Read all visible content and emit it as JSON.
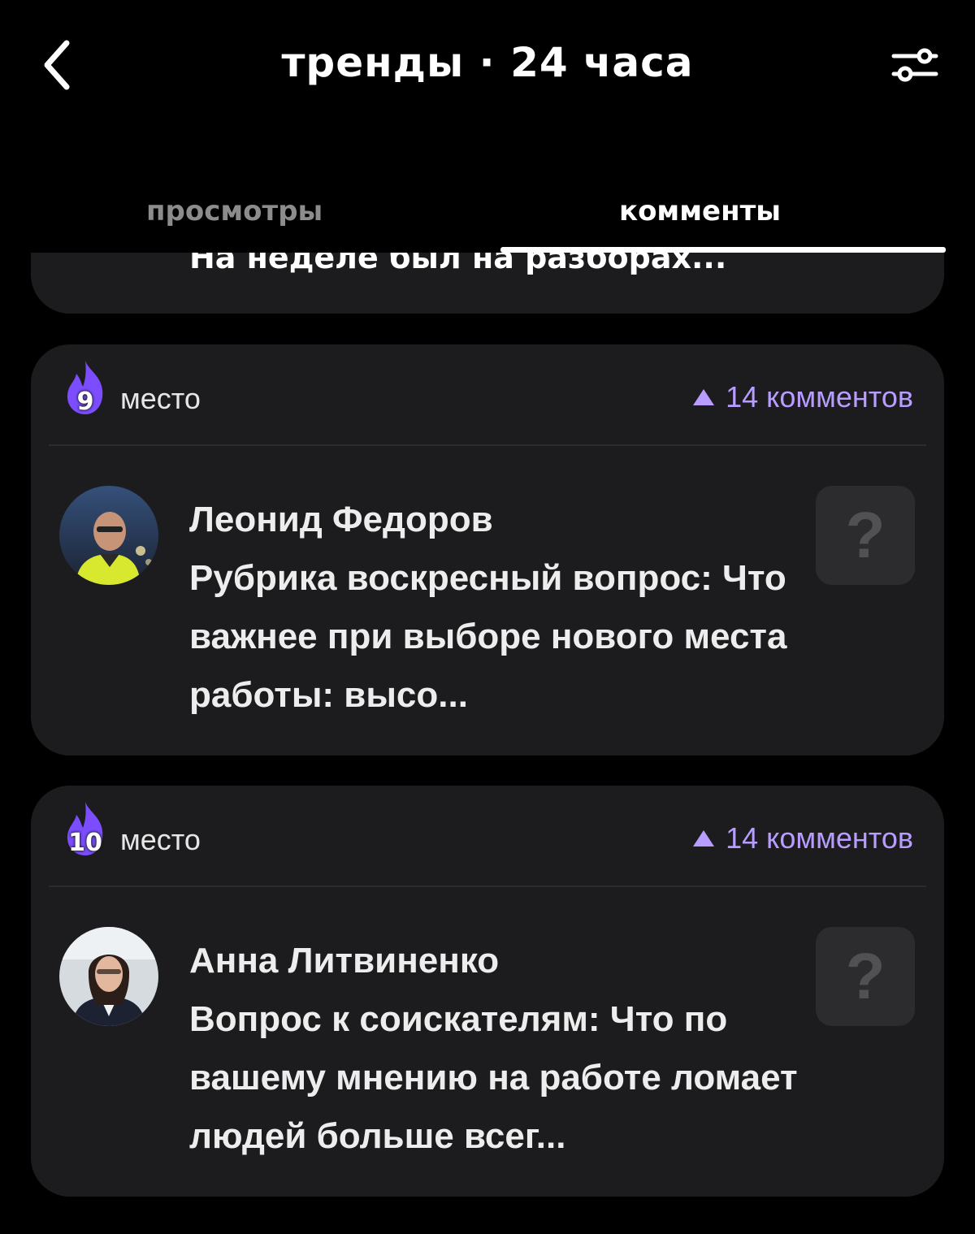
{
  "header": {
    "title": "тренды · 24 часа",
    "back_icon": "chevron-left-icon",
    "filter_icon": "sliders-icon"
  },
  "tabs": [
    {
      "label": "просмотры",
      "active": false
    },
    {
      "label": "комменты",
      "active": true
    }
  ],
  "partial_card": {
    "snippet": "На неделе был на разборах..."
  },
  "cards": [
    {
      "rank": "9",
      "rank_label": "место",
      "comments": "14 комментов",
      "author": "Леонид Федоров",
      "snippet": "Рубрика воскресный вопрос: Что важнее при выборе нового места работы: высо...",
      "badge": "?"
    },
    {
      "rank": "10",
      "rank_label": "место",
      "comments": "14 комментов",
      "author": "Анна Литвиненко",
      "snippet": "Вопрос к соискателям: Что по вашему мнению на работе ломает людей больше всег...",
      "badge": "?"
    }
  ],
  "colors": {
    "accent": "#b89cff",
    "flame": "#7b4dff",
    "card": "#1c1c1e",
    "background": "#000000"
  }
}
